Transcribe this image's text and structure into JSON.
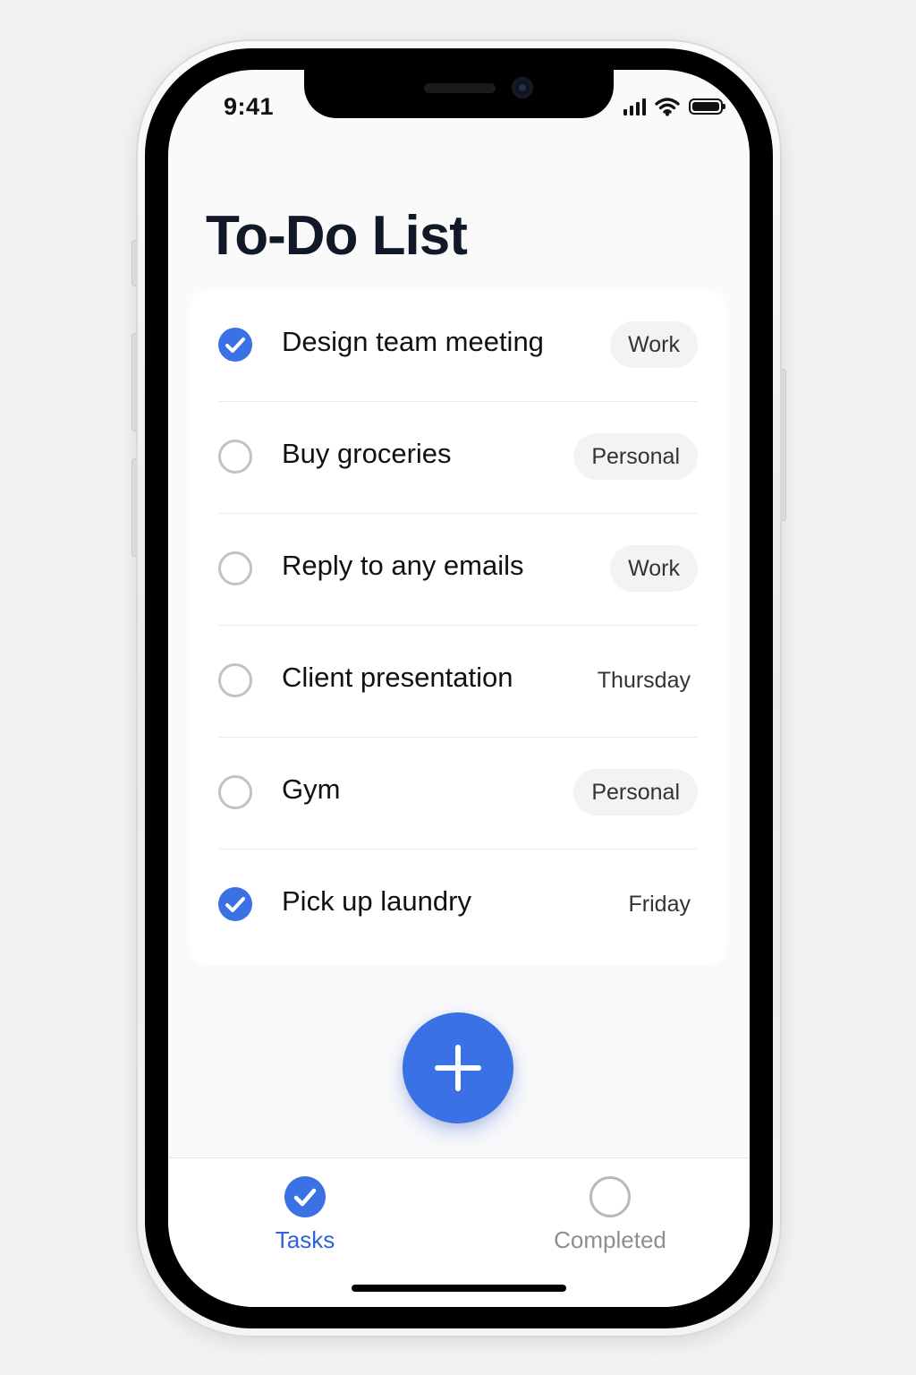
{
  "status_bar": {
    "time": "9:41",
    "icons": [
      "cellular-signal-icon",
      "wifi-icon",
      "battery-icon"
    ]
  },
  "header": {
    "title": "To-Do List"
  },
  "tasks": [
    {
      "label": "Design team meeting",
      "tag": "Work",
      "tag_style": "pill",
      "checked": true
    },
    {
      "label": "Buy groceries",
      "tag": "Personal",
      "tag_style": "pill",
      "checked": false
    },
    {
      "label": "Reply to any emails",
      "tag": "Work",
      "tag_style": "pill",
      "checked": false
    },
    {
      "label": "Client presentation",
      "tag": "Thursday",
      "tag_style": "plain",
      "checked": false
    },
    {
      "label": "Gym",
      "tag": "Personal",
      "tag_style": "pill",
      "checked": false
    },
    {
      "label": "Pick up laundry",
      "tag": "Friday",
      "tag_style": "plain",
      "checked": true
    }
  ],
  "fab": {
    "icon": "plus-icon"
  },
  "tab_bar": {
    "tabs": [
      {
        "label": "Tasks",
        "icon": "check-circle-icon",
        "active": true
      },
      {
        "label": "Completed",
        "icon": "circle-outline-icon",
        "active": false
      }
    ]
  },
  "colors": {
    "accent": "#3a72e6",
    "active_tab_text": "#2f63d6",
    "inactive_tab_text": "#8e8e8e",
    "title": "#111827",
    "background": "#fafafa",
    "card": "#ffffff",
    "pill": "#f3f3f3"
  }
}
